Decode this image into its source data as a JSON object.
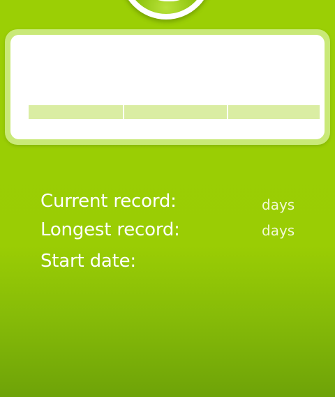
{
  "stats": {
    "current_record": {
      "label": "Current record:",
      "value": "",
      "unit": "days"
    },
    "longest_record": {
      "label": "Longest record:",
      "value": "",
      "unit": "days"
    },
    "start_date": {
      "label": "Start date:",
      "value": ""
    }
  },
  "progress": {
    "segments": 3
  },
  "colors": {
    "background": "#9acd04",
    "card_frame": "#c9e978",
    "card": "#ffffff",
    "segment": "#daeda3",
    "text": "#ffffff"
  }
}
